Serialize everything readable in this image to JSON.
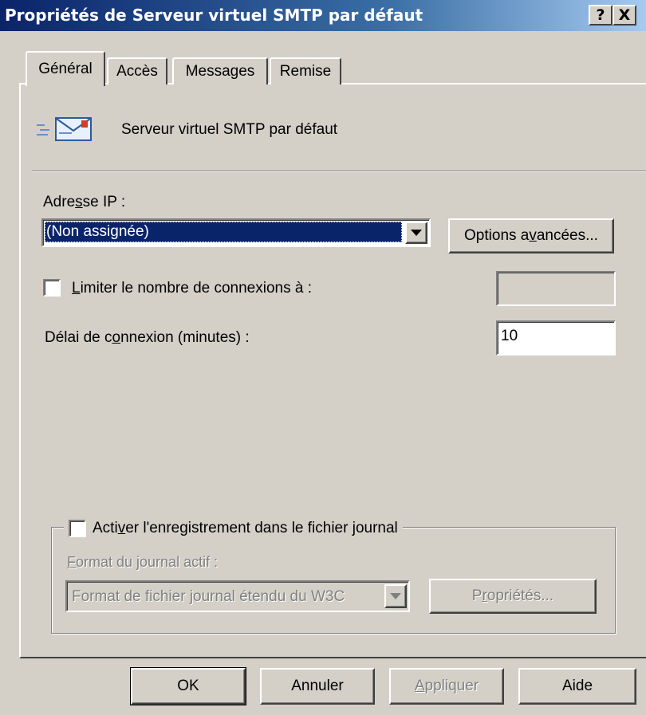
{
  "window": {
    "title": "Propriétés de Serveur virtuel SMTP par défaut",
    "help_button": "?",
    "close_button": "X"
  },
  "tabs": [
    {
      "label": "Général",
      "active": true
    },
    {
      "label": "Accès",
      "active": false
    },
    {
      "label": "Messages",
      "active": false
    },
    {
      "label": "Remise",
      "active": false
    }
  ],
  "general": {
    "server_name": "Serveur virtuel SMTP par défaut",
    "ip_label_pre": "Adre",
    "ip_label_key": "s",
    "ip_label_post": "se IP :",
    "ip_value": "(Non assignée)",
    "advanced_pre": "Options a",
    "advanced_key": "v",
    "advanced_post": "ancées...",
    "limit_key": "L",
    "limit_post": "imiter le nombre de connexions à :",
    "limit_checked": false,
    "limit_value": "",
    "timeout_pre": "Délai de c",
    "timeout_key": "o",
    "timeout_post": "nnexion (minutes) :",
    "timeout_value": "10"
  },
  "logging": {
    "enable_pre": "Acti",
    "enable_key": "v",
    "enable_post": "er l'enregistrement dans le fichier journal",
    "enabled": false,
    "format_key": "F",
    "format_post": "ormat du journal actif :",
    "format_value": "Format de fichier journal étendu du W3C",
    "props_pre": "P",
    "props_key": "r",
    "props_post": "opriétés..."
  },
  "buttons": {
    "ok": "OK",
    "cancel": "Annuler",
    "apply_key": "A",
    "apply_post": "ppliquer",
    "help": "Aide"
  }
}
